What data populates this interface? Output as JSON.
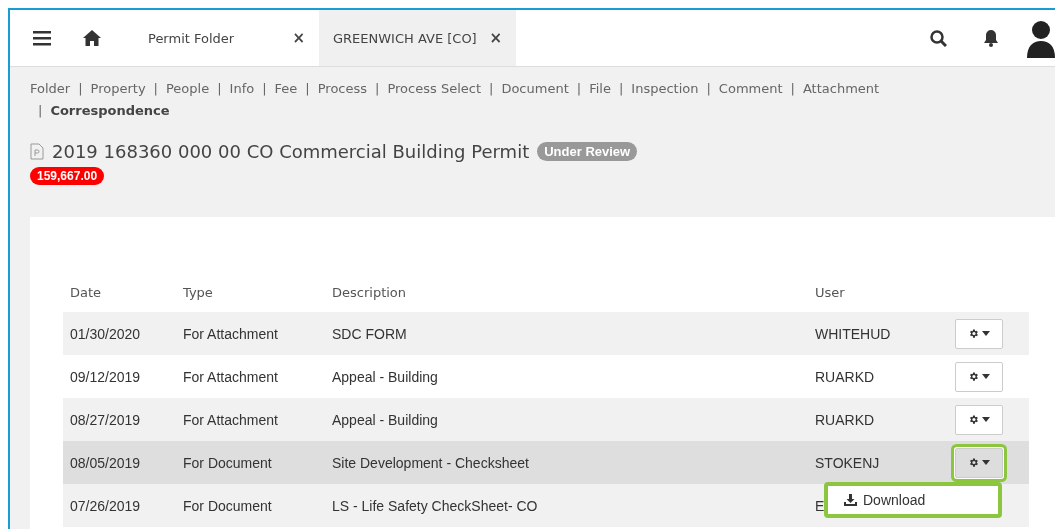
{
  "tabs": [
    {
      "label": "Permit Folder",
      "close": "×",
      "selected": false
    },
    {
      "label": "GREENWICH AVE [CO]",
      "close": "×",
      "selected": true
    }
  ],
  "nav": [
    {
      "label": "Folder",
      "selected": false
    },
    {
      "label": "Property",
      "selected": false
    },
    {
      "label": "People",
      "selected": false
    },
    {
      "label": "Info",
      "selected": false
    },
    {
      "label": "Fee",
      "selected": false
    },
    {
      "label": "Process",
      "selected": false
    },
    {
      "label": "Process Select",
      "selected": false
    },
    {
      "label": "Document",
      "selected": false
    },
    {
      "label": "File",
      "selected": false
    },
    {
      "label": "Inspection",
      "selected": false
    },
    {
      "label": "Comment",
      "selected": false
    },
    {
      "label": "Attachment",
      "selected": false
    },
    {
      "label": "Correspondence",
      "selected": true
    }
  ],
  "separator": "|",
  "folder": {
    "title": "2019 168360 000 00 CO Commercial Building Permit",
    "status": "Under Review",
    "amount": "159,667.00"
  },
  "table": {
    "columns": [
      "Date",
      "Type",
      "Description",
      "User"
    ],
    "rows": [
      {
        "cells": [
          "01/30/2020",
          "For Attachment",
          "SDC FORM",
          "WHITEHUD"
        ],
        "selected": false,
        "highlighted": false,
        "actions": true
      },
      {
        "cells": [
          "09/12/2019",
          "For Attachment",
          "Appeal - Building",
          "RUARKD"
        ],
        "selected": false,
        "highlighted": false,
        "actions": true
      },
      {
        "cells": [
          "08/27/2019",
          "For Attachment",
          "Appeal - Building",
          "RUARKD"
        ],
        "selected": false,
        "highlighted": false,
        "actions": true
      },
      {
        "cells": [
          "08/05/2019",
          "For Document",
          "Site Development - Checksheet",
          "STOKENJ"
        ],
        "selected": true,
        "highlighted": true,
        "actions": true,
        "menu": {
          "label": "Download",
          "highlighted": true
        }
      },
      {
        "cells": [
          "07/26/2019",
          "For Document",
          "LS - Life Safety CheckSheet- CO",
          "E"
        ],
        "selected": false,
        "actions": false
      }
    ]
  }
}
